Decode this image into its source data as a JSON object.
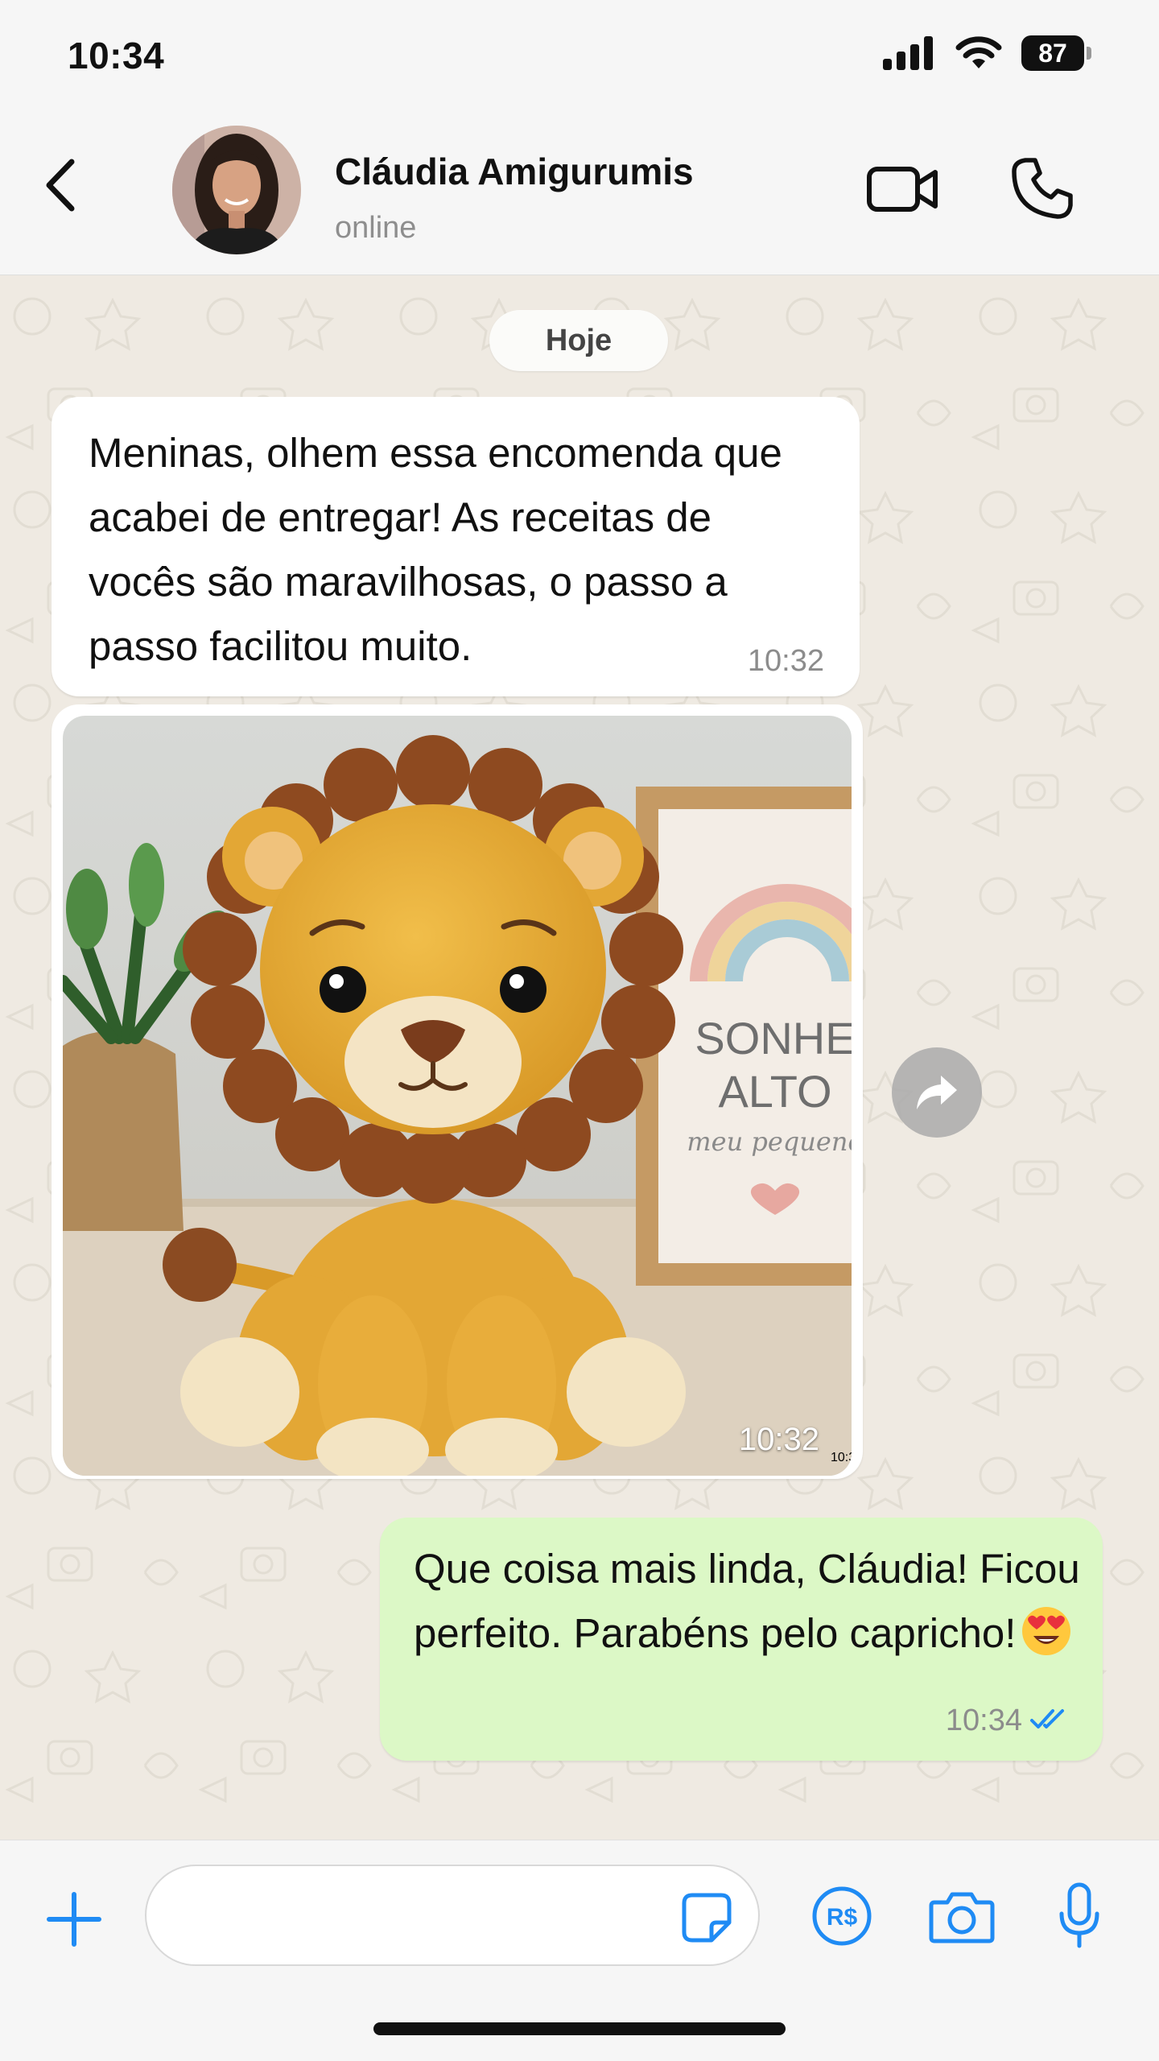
{
  "status_bar": {
    "time": "10:34",
    "battery": "87"
  },
  "header": {
    "contact_name": "Cláudia Amigurumis",
    "contact_status": "online",
    "icons": [
      "back-chevron-icon",
      "video-camera-icon",
      "phone-icon"
    ]
  },
  "chat": {
    "date_chip": "Hoje",
    "messages": [
      {
        "direction": "incoming",
        "type": "text",
        "text": "Meninas, olhem essa encomenda que acabei de entregar! As receitas de vocês são maravilhosas, o passo a passo facilitou muito.",
        "time": "10:32"
      },
      {
        "direction": "incoming",
        "type": "photo",
        "photo_text_line1": "SONHE",
        "photo_text_line2": "ALTO",
        "photo_text_line3": "meu pequeno",
        "time": "10:32"
      },
      {
        "direction": "outgoing",
        "type": "text",
        "text": "Que coisa mais linda, Cláudia! Ficou perfeito. Parabéns pelo capricho!",
        "emoji": "heart-eyes-emoji",
        "time": "10:34",
        "status": "read"
      }
    ]
  },
  "input_bar": {
    "placeholder": "",
    "icons": [
      "plus-icon",
      "sticker-icon",
      "payment-real-icon",
      "camera-icon",
      "microphone-icon"
    ],
    "pay_label": "R$"
  },
  "colors": {
    "accent": "#1f8bf4",
    "outgoing_bubble": "#dcf8c6",
    "incoming_bubble": "#ffffff",
    "chat_background": "#efeae2"
  }
}
